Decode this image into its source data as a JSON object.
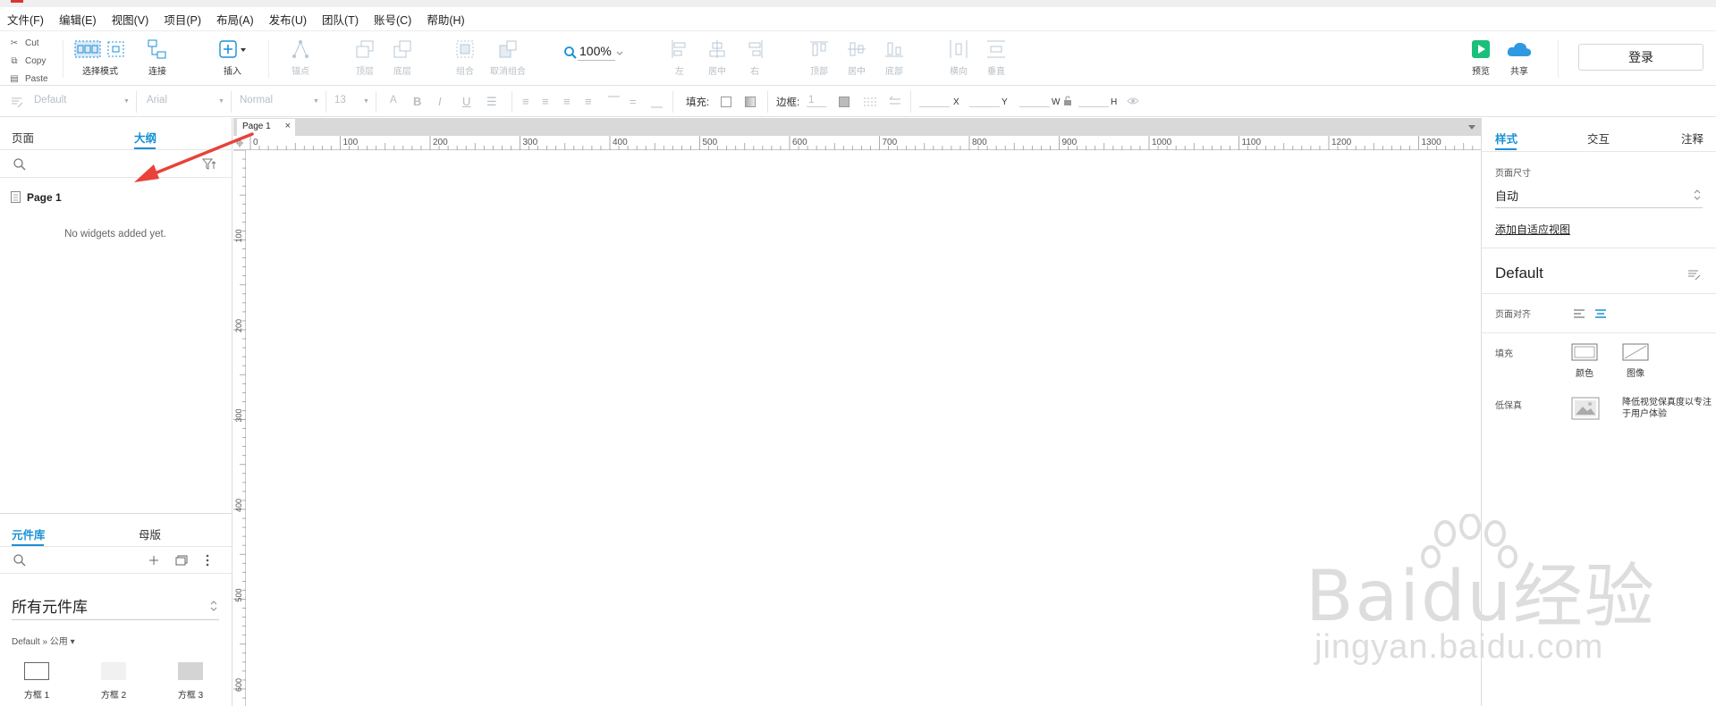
{
  "menu": [
    "文件(F)",
    "编辑(E)",
    "视图(V)",
    "项目(P)",
    "布局(A)",
    "发布(U)",
    "团队(T)",
    "账号(C)",
    "帮助(H)"
  ],
  "clipboard": {
    "cut": "Cut",
    "copy": "Copy",
    "paste": "Paste"
  },
  "toolbar": {
    "select_mode": "选择模式",
    "connect": "连接",
    "insert": "插入",
    "point": "锚点",
    "top": "顶层",
    "bottom": "底层",
    "group": "组合",
    "ungroup": "取消组合",
    "zoom": "100%",
    "align_left": "左",
    "align_center": "居中",
    "align_right": "右",
    "align_top": "顶部",
    "align_middle": "居中",
    "align_bottom": "底部",
    "dist_h": "横向",
    "dist_v": "垂直",
    "preview": "预览",
    "share": "共享",
    "login": "登录"
  },
  "format": {
    "style": "Default",
    "font": "Arial",
    "weight": "Normal",
    "size": "13",
    "fill_label": "填充:",
    "border_label": "边框:",
    "border_value": "1",
    "x": "X",
    "y": "Y",
    "w": "W",
    "h": "H"
  },
  "left": {
    "tabs": {
      "pages": "页面",
      "outline": "大纲"
    },
    "outline_page": "Page 1",
    "empty": "No widgets added yet.",
    "lib_tabs": {
      "library": "元件库",
      "masters": "母版"
    },
    "lib_title": "所有元件库",
    "lib_path": "Default » 公用 ▾",
    "widgets": [
      "方框 1",
      "方框 2",
      "方框 3"
    ]
  },
  "canvas": {
    "tab": "Page 1",
    "hticks": [
      "0",
      "100",
      "200",
      "300",
      "400",
      "500",
      "600",
      "700",
      "800",
      "900",
      "1000",
      "1100",
      "1200",
      "1300"
    ],
    "vticks": [
      "100",
      "200",
      "300",
      "400",
      "500",
      "600"
    ]
  },
  "right": {
    "tabs": {
      "style": "样式",
      "interact": "交互",
      "notes": "注释"
    },
    "page_size_label": "页面尺寸",
    "page_size": "自动",
    "adaptive_link": "添加自适应视图",
    "style_name": "Default",
    "align_label": "页面对齐",
    "fill_label": "填充",
    "fill_color": "颜色",
    "fill_image": "图像",
    "lofi_label": "低保真",
    "lofi_desc": "降低视觉保真度以专注于用户体验"
  },
  "watermark": {
    "brand": "Baidu经验",
    "url": "jingyan.baidu.com"
  },
  "colors": {
    "accent": "#1890d5",
    "arrow": "#e8423a",
    "preview": "#1bbf7a",
    "share": "#2f98e3"
  }
}
